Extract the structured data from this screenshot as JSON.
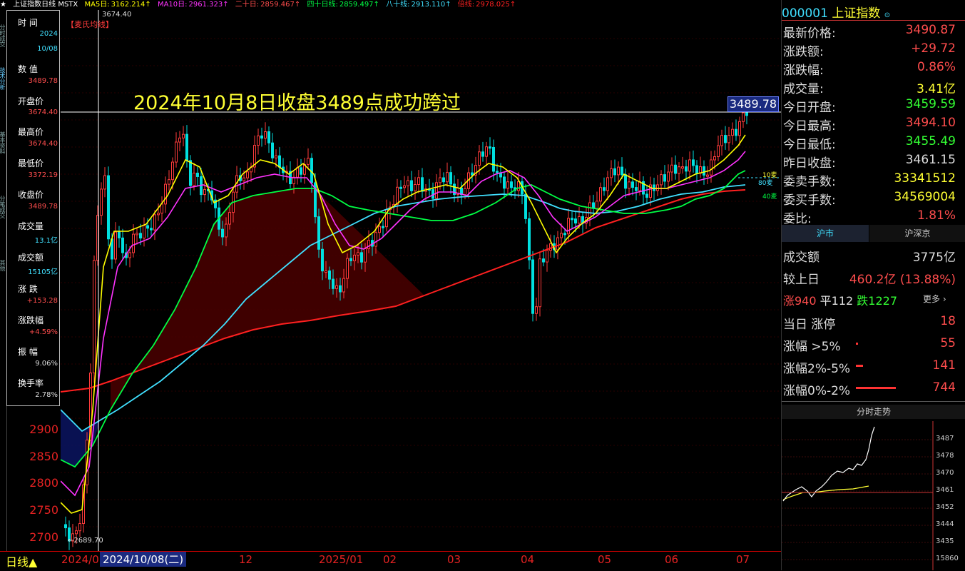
{
  "top_bar": {
    "title": "上证指数日线 MSTX",
    "ma5_label": "MA5日:",
    "ma5": "3162.214↑",
    "ma10_label": "MA10日:",
    "ma10": "2961.323↑",
    "ma20_label": "二十日:",
    "ma20": "2859.467↑",
    "ma40_label": "四十日线:",
    "ma40": "2859.497↑",
    "ma80_label": "八十线:",
    "ma80": "2913.110↑",
    "ma_long_label": "倍线:",
    "ma_long": "2978.025↑"
  },
  "chart": {
    "indicator_tag": "【麦氏均线】",
    "high_mark": "3674.40",
    "low_mark": "←2689.70",
    "annotation": "2024年10月8日收盘3489点成功跨过",
    "price_tag": "3489.78",
    "line_tags": [
      "10麦",
      "80麦",
      "40麦"
    ],
    "price_labels": [
      "2900",
      "2850",
      "2800",
      "2750",
      "2700"
    ],
    "date_labels": [
      "2024/0",
      "2024/10/08(二)",
      "12",
      "2025/01",
      "02",
      "03",
      "04",
      "05",
      "06",
      "07"
    ],
    "period_label": "日线▲",
    "colors": {
      "up": "#ff3b3b",
      "down": "#00e0e0",
      "ma5": "#ffff00",
      "ma10": "#ff33ff",
      "ma20": "#00ff44",
      "ma40": "#40e0ff",
      "ma_long": "#ff2020"
    }
  },
  "left_panel": {
    "time_label": "时 间",
    "year": "2024",
    "date": "10/08",
    "value_label": "数 值",
    "value": "3489.78",
    "open_label": "开盘价",
    "open": "3674.40",
    "high_label": "最高价",
    "high": "3674.40",
    "low_label": "最低价",
    "low": "3372.19",
    "close_label": "收盘价",
    "close": "3489.78",
    "vol_label": "成交量",
    "vol": "13.1亿",
    "amount_label": "成交额",
    "amount": "15105亿",
    "change_label": "涨 跌",
    "change": "+153.28",
    "change_pct_label": "涨跌幅",
    "change_pct": "+4.59%",
    "amplitude_label": "振 幅",
    "amplitude": "9.06%",
    "turnover_label": "换手率",
    "turnover": "2.78%"
  },
  "left_strip": [
    "分时成交",
    "技术分析",
    "基本资料",
    "分笔成交",
    "其他"
  ],
  "right_panel": {
    "code": "000001",
    "name": "上证指数",
    "rows": [
      {
        "k": "最新价格:",
        "v": "3490.87",
        "c": "#ff4d4d"
      },
      {
        "k": "涨跌额:",
        "v": "+29.72",
        "c": "#ff4d4d"
      },
      {
        "k": "涨跌幅:",
        "v": "0.86%",
        "c": "#ff4d4d"
      },
      {
        "k": "成交量:",
        "v": "3.41亿",
        "c": "#ffff33"
      },
      {
        "k": "今日开盘:",
        "v": "3459.59",
        "c": "#33ff33"
      },
      {
        "k": "今日最高:",
        "v": "3494.10",
        "c": "#ff4d4d"
      },
      {
        "k": "今日最低:",
        "v": "3455.49",
        "c": "#33ff33"
      },
      {
        "k": "昨日收盘:",
        "v": "3461.15",
        "c": "#dddddd"
      },
      {
        "k": "委卖手数:",
        "v": "33341512",
        "c": "#ffff33"
      },
      {
        "k": "委买手数:",
        "v": "34569004",
        "c": "#ffff33"
      },
      {
        "k": "委比:",
        "v": "1.81%",
        "c": "#ff4d4d"
      }
    ],
    "tab_sh": "沪市",
    "tab_shsz": "沪深京",
    "turnover_label": "成交额",
    "turnover": "3775亿",
    "vs_prev_label": "较上日",
    "vs_prev": "460.2亿 (13.88%)",
    "up_count": "涨940",
    "flat_count": "平112",
    "down_count": "跌1227",
    "more": "更多 ›",
    "limit_up_label": "当日 涨停",
    "limit_up": "18",
    "gt5_label": "涨幅 >5%",
    "gt5": "55",
    "r2_5_label": "涨幅2%-5%",
    "r2_5": "141",
    "r0_2_label": "涨幅0%-2%",
    "r0_2": "744",
    "intraday_title": "分时走势",
    "intraday_labels": [
      "3487",
      "3478",
      "3470",
      "3461",
      "3452",
      "3444",
      "3435",
      "15860"
    ]
  }
}
